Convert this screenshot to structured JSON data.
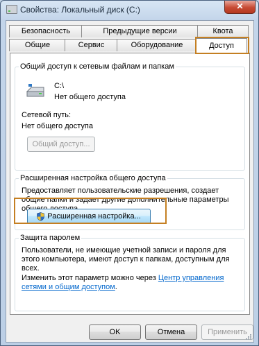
{
  "window": {
    "title": "Свойства: Локальный диск (C:)",
    "close_glyph": "✕"
  },
  "tabs_back": [
    "Безопасность",
    "Предыдущие версии",
    "Квота"
  ],
  "tabs_front": [
    "Общие",
    "Сервис",
    "Оборудование",
    "Доступ"
  ],
  "active_tab": "Доступ",
  "sharing": {
    "group_title": "Общий доступ к сетевым файлам и папкам",
    "drive_label": "C:\\",
    "drive_status": "Нет общего доступа",
    "network_path_label": "Сетевой путь:",
    "network_path_value": "Нет общего доступа",
    "share_button": "Общий доступ..."
  },
  "advanced": {
    "group_title": "Расширенная настройка общего доступа",
    "description": "Предоставляет пользовательские разрешения, создает общие папки и задает другие дополнительные параметры общего доступа.",
    "button": "Расширенная настройка..."
  },
  "password": {
    "group_title": "Защита паролем",
    "description": "Пользователи, не имеющие учетной записи и пароля для этого компьютера, имеют доступ к папкам, доступным для всех.",
    "change_prefix": "Изменить этот параметр можно через",
    "link_part1": "Центр управления",
    "link_part2": "сетями и общим доступом",
    "link_suffix": "."
  },
  "footer": {
    "ok": "OK",
    "cancel": "Отмена",
    "apply": "Применить"
  },
  "colors": {
    "highlight": "#c47f22",
    "link": "#0066cc",
    "close_button": "#c74a33"
  }
}
